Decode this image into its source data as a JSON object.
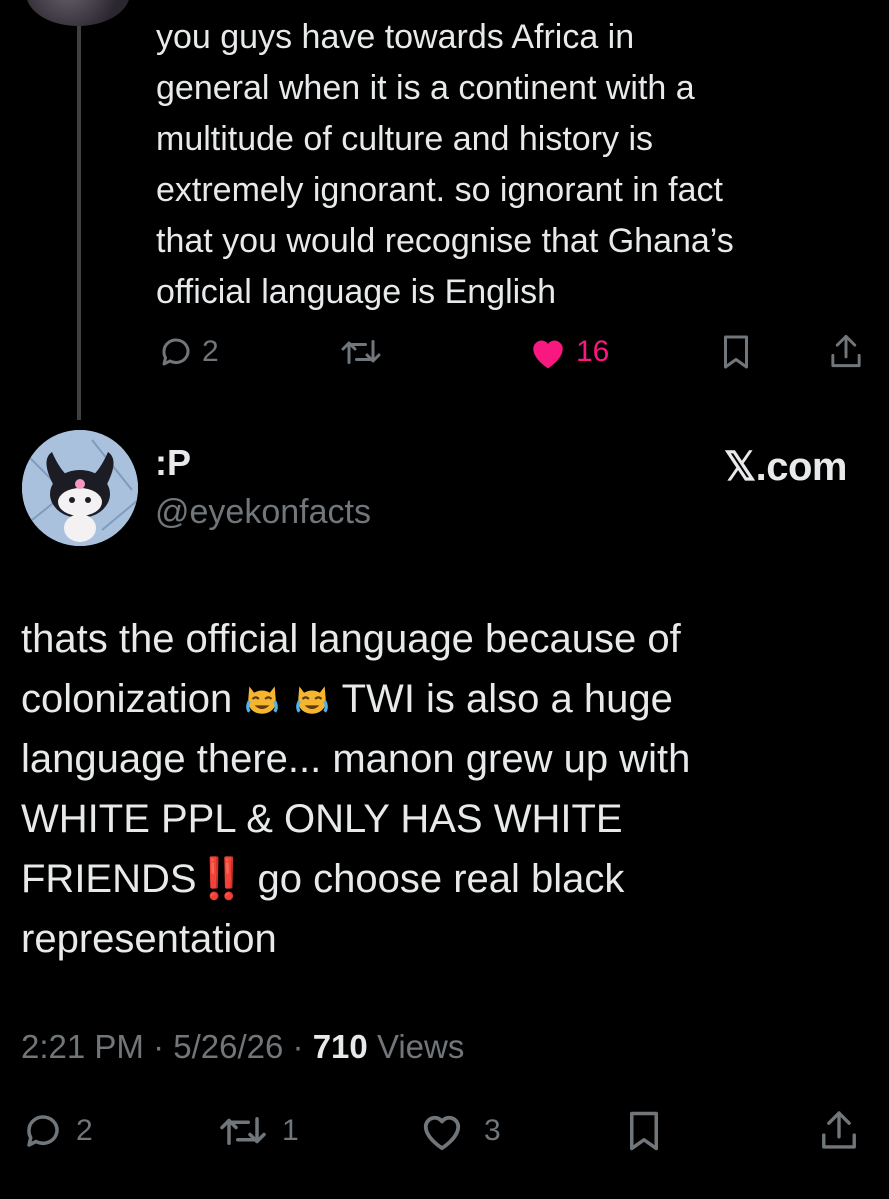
{
  "parent_tweet": {
    "lines": [
      "you guys have towards Africa in",
      "general when it is a continent with a",
      "multitude of culture and history is",
      "extremely ignorant. so ignorant in fact",
      "that you would recognise that Ghana’s",
      "official language is English"
    ],
    "reply_count": "2",
    "like_count": "16",
    "liked": true
  },
  "reply_tweet": {
    "display_name": ":P",
    "handle": "@eyekonfacts",
    "watermark": "𝕏.com",
    "lines": {
      "l1": "thats the official language because of",
      "l2_a": "colonization",
      "l2_b": "TWI is also a huge",
      "l3": "language there... manon grew up with",
      "l4": "WHITE PPL & ONLY HAS WHITE",
      "l5_a": "FRIENDS",
      "l5_bang": "‼️",
      "l5_b": "go choose real black",
      "l6": "representation"
    },
    "time": "2:21 PM",
    "date": "5/26/26",
    "views_count": "710",
    "views_label": "Views",
    "reply_count": "2",
    "repost_count": "1",
    "like_count": "3"
  },
  "icons": [
    "reply-icon",
    "repost-icon",
    "like-icon",
    "bookmark-icon",
    "share-icon",
    "crying-laughing-cat-emoji"
  ],
  "colors": {
    "background": "#000000",
    "text": "#e7e9ea",
    "muted": "#71767b",
    "like": "#f91880"
  }
}
